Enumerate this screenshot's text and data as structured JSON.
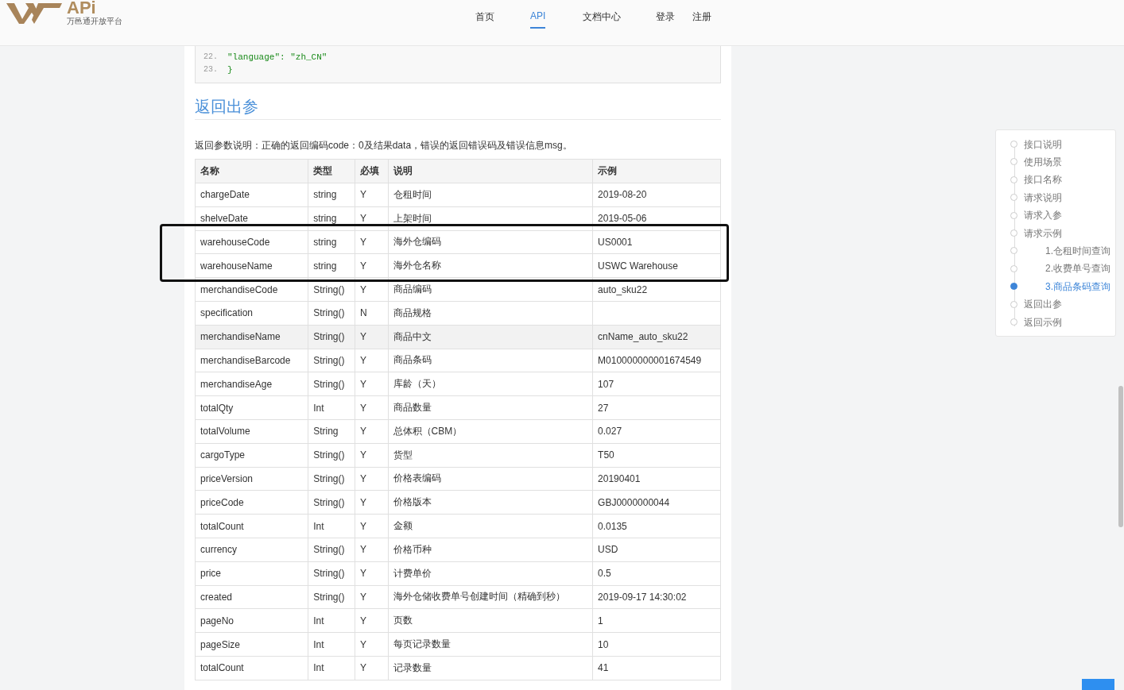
{
  "header": {
    "logo_text": "APi",
    "logo_subtitle": "万邑通开放平台",
    "nav": [
      {
        "label": "首页",
        "selected": false
      },
      {
        "label": "API",
        "selected": true
      },
      {
        "label": "文档中心",
        "selected": false
      },
      {
        "label": "登录",
        "selected": false
      },
      {
        "label": "注册",
        "selected": false
      }
    ]
  },
  "code_block": {
    "lines": [
      {
        "number": "22.",
        "text": "\"language\": \"zh_CN\""
      },
      {
        "number": "23.",
        "text": "}"
      }
    ]
  },
  "section": {
    "title": "返回出参",
    "description": "返回参数说明：正确的返回编码code：0及结果data，错误的返回错误码及错误信息msg。"
  },
  "table": {
    "columns": [
      "名称",
      "类型",
      "必填",
      "说明",
      "示例"
    ],
    "rows": [
      {
        "cells": [
          "chargeDate",
          "string",
          "Y",
          "仓租时间",
          "2019-08-20"
        ],
        "hovered": false,
        "framed": false
      },
      {
        "cells": [
          "shelveDate",
          "string",
          "Y",
          "上架时间",
          "2019-05-06"
        ],
        "hovered": false,
        "framed": false
      },
      {
        "cells": [
          "warehouseCode",
          "string",
          "Y",
          "海外仓编码",
          "US0001"
        ],
        "hovered": false,
        "framed": true
      },
      {
        "cells": [
          "warehouseName",
          "string",
          "Y",
          "海外仓名称",
          "USWC Warehouse"
        ],
        "hovered": false,
        "framed": true
      },
      {
        "cells": [
          "merchandiseCode",
          "String()",
          "Y",
          "商品编码",
          "auto_sku22"
        ],
        "hovered": false,
        "framed": false
      },
      {
        "cells": [
          "specification",
          "String()",
          "N",
          "商品规格",
          ""
        ],
        "hovered": false,
        "framed": false
      },
      {
        "cells": [
          "merchandiseName",
          "String()",
          "Y",
          "商品中文",
          "cnName_auto_sku22"
        ],
        "hovered": true,
        "framed": false
      },
      {
        "cells": [
          "merchandiseBarcode",
          "String()",
          "Y",
          "商品条码",
          "M010000000001674549"
        ],
        "hovered": false,
        "framed": false
      },
      {
        "cells": [
          "merchandiseAge",
          "String()",
          "Y",
          "库龄（天）",
          "107"
        ],
        "hovered": false,
        "framed": false
      },
      {
        "cells": [
          "totalQty",
          "Int",
          "Y",
          "商品数量",
          "27"
        ],
        "hovered": false,
        "framed": false
      },
      {
        "cells": [
          "totalVolume",
          "String",
          "Y",
          "总体积（CBM）",
          "0.027"
        ],
        "hovered": false,
        "framed": false
      },
      {
        "cells": [
          "cargoType",
          "String()",
          "Y",
          "货型",
          "T50"
        ],
        "hovered": false,
        "framed": false
      },
      {
        "cells": [
          "priceVersion",
          "String()",
          "Y",
          "价格表编码",
          "20190401"
        ],
        "hovered": false,
        "framed": false
      },
      {
        "cells": [
          "priceCode",
          "String()",
          "Y",
          "价格版本",
          "GBJ0000000044"
        ],
        "hovered": false,
        "framed": false
      },
      {
        "cells": [
          "totalCount",
          "Int",
          "Y",
          "金额",
          "0.0135"
        ],
        "hovered": false,
        "framed": false
      },
      {
        "cells": [
          "currency",
          "String()",
          "Y",
          "价格币种",
          "USD"
        ],
        "hovered": false,
        "framed": false
      },
      {
        "cells": [
          "price",
          "String()",
          "Y",
          "计费单价",
          "0.5"
        ],
        "hovered": false,
        "framed": false
      },
      {
        "cells": [
          "created",
          "String()",
          "Y",
          "海外仓储收费单号创建时间（精确到秒）",
          "2019-09-17 14:30:02"
        ],
        "hovered": false,
        "framed": false
      },
      {
        "cells": [
          "pageNo",
          "Int",
          "Y",
          "页数",
          "1"
        ],
        "hovered": false,
        "framed": false
      },
      {
        "cells": [
          "pageSize",
          "Int",
          "Y",
          "每页记录数量",
          "10"
        ],
        "hovered": false,
        "framed": false
      },
      {
        "cells": [
          "totalCount",
          "Int",
          "Y",
          "记录数量",
          "41"
        ],
        "hovered": false,
        "framed": false
      }
    ]
  },
  "toc": {
    "items": [
      {
        "label": "接口说明",
        "selected": false
      },
      {
        "label": "使用场景",
        "selected": false
      },
      {
        "label": "接口名称",
        "selected": false
      },
      {
        "label": "请求说明",
        "selected": false
      },
      {
        "label": "请求入参",
        "selected": false
      },
      {
        "label": "请求示例",
        "selected": false,
        "children": [
          {
            "label": "1.仓租时间查询",
            "selected": false
          },
          {
            "label": "2.收费单号查询",
            "selected": false
          },
          {
            "label": "3.商品条码查询",
            "selected": true
          }
        ]
      },
      {
        "label": "返回出参",
        "selected": false
      },
      {
        "label": "返回示例",
        "selected": false
      }
    ]
  }
}
